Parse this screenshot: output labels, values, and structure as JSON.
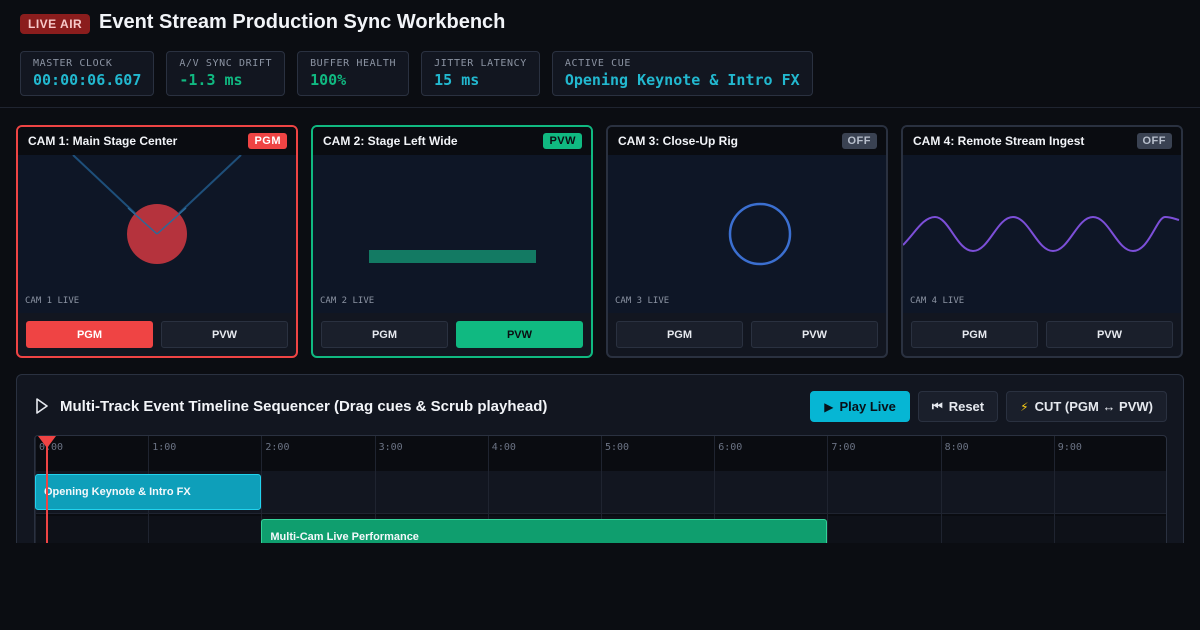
{
  "header": {
    "badge": "LIVE AIR",
    "title": "Event Stream Production Sync Workbench"
  },
  "stats": [
    {
      "label": "MASTER CLOCK",
      "value": "00:00:06.607",
      "color": "#22b8cf"
    },
    {
      "label": "A/V SYNC DRIFT",
      "value": "-1.3 ms",
      "color": "#10b981"
    },
    {
      "label": "BUFFER HEALTH",
      "value": "100%",
      "color": "#10b981"
    },
    {
      "label": "JITTER LATENCY",
      "value": "15 ms",
      "color": "#22b8cf"
    },
    {
      "label": "ACTIVE CUE",
      "value": "Opening Keynote & Intro FX",
      "color": "#22b8cf"
    }
  ],
  "cameras": [
    {
      "title": "CAM 1: Main Stage Center",
      "state": "PGM",
      "live": "CAM 1 LIVE",
      "pgm_label": "PGM",
      "pvw_label": "PVW"
    },
    {
      "title": "CAM 2: Stage Left Wide",
      "state": "PVW",
      "live": "CAM 2 LIVE",
      "pgm_label": "PGM",
      "pvw_label": "PVW"
    },
    {
      "title": "CAM 3: Close-Up Rig",
      "state": "OFF",
      "live": "CAM 3 LIVE",
      "pgm_label": "PGM",
      "pvw_label": "PVW"
    },
    {
      "title": "CAM 4: Remote Stream Ingest",
      "state": "OFF",
      "live": "CAM 4 LIVE",
      "pgm_label": "PGM",
      "pvw_label": "PVW"
    }
  ],
  "sequencer": {
    "title": "Multi-Track Event Timeline Sequencer (Drag cues & Scrub playhead)",
    "play_label": "Play Live",
    "reset_label": "Reset",
    "cut_label": "CUT (PGM ↔ PVW)",
    "ticks": [
      "0:00",
      "1:00",
      "2:00",
      "3:00",
      "4:00",
      "5:00",
      "6:00",
      "7:00",
      "8:00",
      "9:00"
    ],
    "cues": [
      {
        "label": "Opening Keynote & Intro FX",
        "start_min": 0,
        "end_min": 2
      },
      {
        "label": "Multi-Cam Live Performance",
        "start_min": 2,
        "end_min": 7
      }
    ],
    "playhead_min": 0.11
  },
  "colors": {
    "pgm": "#ef4444",
    "pvw": "#10b981",
    "accent": "#06b6d4"
  }
}
